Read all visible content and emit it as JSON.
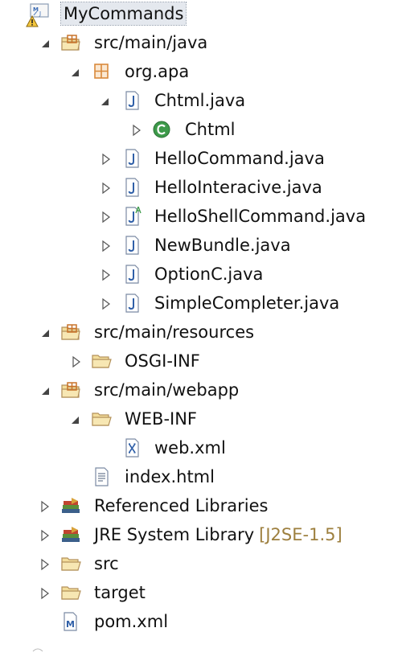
{
  "tree": {
    "project": {
      "label": "MyCommands",
      "expanded": true,
      "icon": "project-icon",
      "badge": "warning-overlay-icon"
    },
    "src_main_java": {
      "label": "src/main/java",
      "expanded": true,
      "icon": "source-folder-icon"
    },
    "package_org_apa": {
      "label": "org.apa",
      "expanded": true,
      "icon": "package-icon"
    },
    "chtml_java": {
      "label": "Chtml.java",
      "expanded": true,
      "icon": "java-file-icon"
    },
    "chtml_class": {
      "label": "Chtml",
      "expanded": false,
      "icon": "class-icon"
    },
    "hello_command": {
      "label": "HelloCommand.java",
      "expanded": false,
      "icon": "java-file-icon"
    },
    "hello_interacive": {
      "label": "HelloInteracive.java",
      "expanded": false,
      "icon": "java-file-icon"
    },
    "hello_shell_command": {
      "label": "HelloShellCommand.java",
      "expanded": false,
      "icon": "java-abstract-file-icon"
    },
    "new_bundle": {
      "label": "NewBundle.java",
      "expanded": false,
      "icon": "java-file-icon"
    },
    "option_c": {
      "label": "OptionC.java",
      "expanded": false,
      "icon": "java-file-icon"
    },
    "simple_completer": {
      "label": "SimpleCompleter.java",
      "expanded": false,
      "icon": "java-file-icon"
    },
    "src_main_resources": {
      "label": "src/main/resources",
      "expanded": true,
      "icon": "source-folder-icon"
    },
    "osgi_inf": {
      "label": "OSGI-INF",
      "expanded": false,
      "icon": "folder-icon"
    },
    "src_main_webapp": {
      "label": "src/main/webapp",
      "expanded": true,
      "icon": "source-folder-icon"
    },
    "web_inf": {
      "label": "WEB-INF",
      "expanded": true,
      "icon": "folder-icon"
    },
    "web_xml": {
      "label": "web.xml",
      "icon": "xml-file-icon"
    },
    "index_html": {
      "label": "index.html",
      "icon": "html-file-icon"
    },
    "referenced_libraries": {
      "label": "Referenced Libraries",
      "expanded": false,
      "icon": "library-icon"
    },
    "jre_system_library": {
      "label": "JRE System Library",
      "decoration": "[J2SE-1.5]",
      "expanded": false,
      "icon": "library-icon"
    },
    "src": {
      "label": "src",
      "expanded": false,
      "icon": "folder-icon"
    },
    "target": {
      "label": "target",
      "expanded": false,
      "icon": "folder-icon"
    },
    "pom_xml": {
      "label": "pom.xml",
      "icon": "maven-file-icon"
    }
  },
  "colors": {
    "java_icon_blue": "#2f5fa8",
    "class_icon_green": "#3d9a4a",
    "folder_fill": "#f3dd9b",
    "folder_stroke": "#b3915a",
    "package_orange": "#d9893b",
    "library_green": "#5b8f3a",
    "decoration_brown": "#9d7f3e"
  }
}
